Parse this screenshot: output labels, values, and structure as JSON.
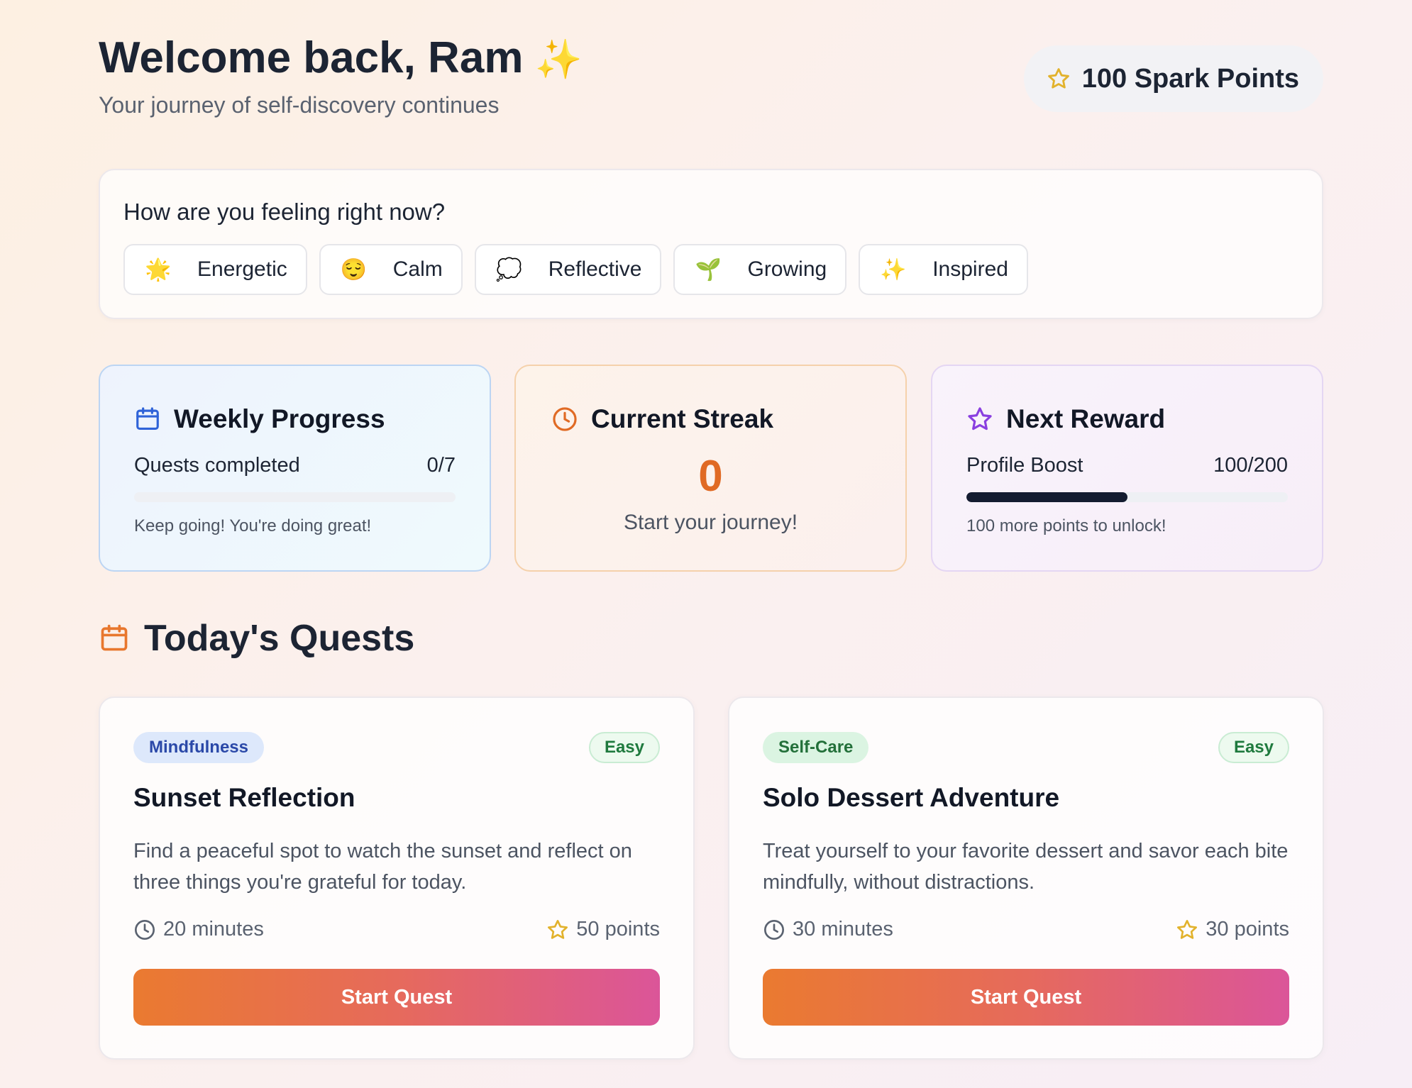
{
  "header": {
    "welcome": "Welcome back, Ram",
    "welcome_emoji": "✨",
    "subtitle": "Your journey of self-discovery continues",
    "points_label": "100 Spark Points",
    "points_icon": "star-icon"
  },
  "mood": {
    "question": "How are you feeling right now?",
    "options": [
      {
        "emoji": "🌟",
        "label": "Energetic"
      },
      {
        "emoji": "😌",
        "label": "Calm"
      },
      {
        "emoji": "💭",
        "label": "Reflective"
      },
      {
        "emoji": "🌱",
        "label": "Growing"
      },
      {
        "emoji": "✨",
        "label": "Inspired"
      }
    ]
  },
  "weekly_progress": {
    "title": "Weekly Progress",
    "icon": "calendar-icon",
    "row_label": "Quests completed",
    "row_value": "0/7",
    "progress_fraction": 0,
    "note": "Keep going! You're doing great!"
  },
  "streak": {
    "title": "Current Streak",
    "icon": "clock-icon",
    "value": "0",
    "note": "Start your journey!"
  },
  "next_reward": {
    "title": "Next Reward",
    "icon": "star-icon",
    "row_label": "Profile Boost",
    "row_value": "100/200",
    "progress_fraction": 0.5,
    "note": "100 more points to unlock!"
  },
  "quests": {
    "heading": "Today's Quests",
    "items": [
      {
        "category": "Mindfulness",
        "difficulty": "Easy",
        "title": "Sunset Reflection",
        "description": "Find a peaceful spot to watch the sunset and reflect on three things you're grateful for today.",
        "duration": "20 minutes",
        "points": "50 points",
        "button": "Start Quest"
      },
      {
        "category": "Self-Care",
        "difficulty": "Easy",
        "title": "Solo Dessert Adventure",
        "description": "Treat yourself to your favorite dessert and savor each bite mindfully, without distractions.",
        "duration": "30 minutes",
        "points": "30 points",
        "button": "Start Quest"
      }
    ]
  },
  "colors": {
    "accent_orange": "#e06a24",
    "star_gold": "#e2b22c",
    "reward_purple": "#8a3fe0",
    "calendar_blue": "#2f63d8",
    "button_gradient_start": "#ea7a30",
    "button_gradient_end": "#db5599"
  }
}
